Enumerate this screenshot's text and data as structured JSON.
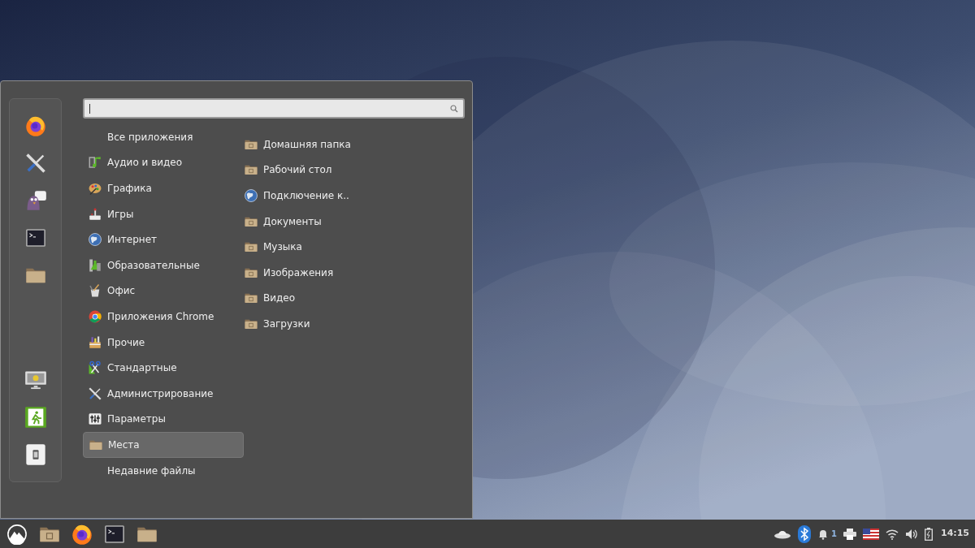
{
  "categories": [
    {
      "label": "Все приложения",
      "selected": false,
      "kind": "text"
    },
    {
      "label": "Аудио и видео",
      "selected": false,
      "kind": "icon"
    },
    {
      "label": "Графика",
      "selected": false,
      "kind": "icon"
    },
    {
      "label": "Игры",
      "selected": false,
      "kind": "icon"
    },
    {
      "label": "Интернет",
      "selected": false,
      "kind": "icon"
    },
    {
      "label": "Образовательные",
      "selected": false,
      "kind": "icon"
    },
    {
      "label": "Офис",
      "selected": false,
      "kind": "icon"
    },
    {
      "label": "Приложения Chrome",
      "selected": false,
      "kind": "icon"
    },
    {
      "label": "Прочие",
      "selected": false,
      "kind": "icon"
    },
    {
      "label": "Стандартные",
      "selected": false,
      "kind": "icon"
    },
    {
      "label": "Администрирование",
      "selected": false,
      "kind": "icon"
    },
    {
      "label": "Параметры",
      "selected": false,
      "kind": "icon"
    },
    {
      "label": "Места",
      "selected": true,
      "kind": "icon"
    },
    {
      "label": "Недавние файлы",
      "selected": false,
      "kind": "text"
    }
  ],
  "places": [
    {
      "label": "Домашняя папка"
    },
    {
      "label": "Рабочий стол"
    },
    {
      "label": "Подключение к.."
    },
    {
      "label": "Документы"
    },
    {
      "label": "Музыка"
    },
    {
      "label": "Изображения"
    },
    {
      "label": "Видео"
    },
    {
      "label": "Загрузки"
    }
  ],
  "taskbar": {
    "notification_count": "1",
    "clock": "14:15"
  }
}
